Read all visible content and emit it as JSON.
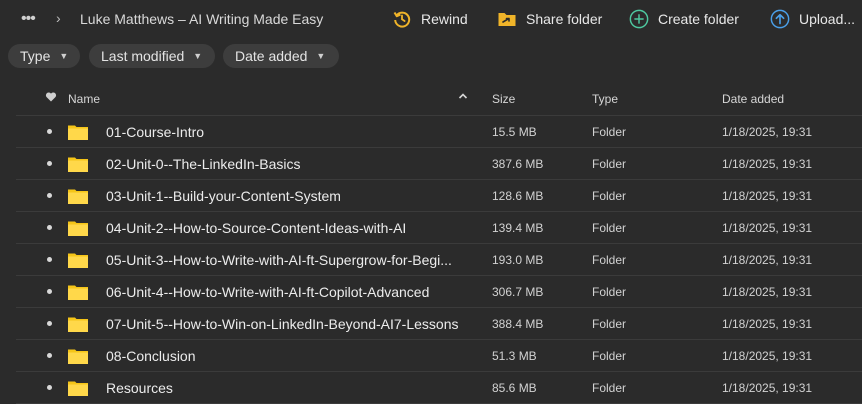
{
  "header": {
    "breadcrumb": "Luke Matthews – AI Writing Made Easy",
    "actions": [
      {
        "label": "Rewind",
        "icon": "rewind-icon",
        "color": "#f0b429"
      },
      {
        "label": "Share folder",
        "icon": "share-folder-icon",
        "color": "#f0b429"
      },
      {
        "label": "Create folder",
        "icon": "create-folder-icon",
        "color": "#4ec9a0"
      },
      {
        "label": "Upload...",
        "icon": "upload-icon",
        "color": "#4a9fe8"
      }
    ]
  },
  "filters": [
    {
      "label": "Type"
    },
    {
      "label": "Last modified"
    },
    {
      "label": "Date added"
    }
  ],
  "table": {
    "columns": {
      "name": "Name",
      "size": "Size",
      "type": "Type",
      "date": "Date added"
    },
    "rows": [
      {
        "name": "01-Course-Intro",
        "size": "15.5 MB",
        "type": "Folder",
        "date": "1/18/2025, 19:31"
      },
      {
        "name": "02-Unit-0--The-LinkedIn-Basics",
        "size": "387.6 MB",
        "type": "Folder",
        "date": "1/18/2025, 19:31"
      },
      {
        "name": "03-Unit-1--Build-your-Content-System",
        "size": "128.6 MB",
        "type": "Folder",
        "date": "1/18/2025, 19:31"
      },
      {
        "name": "04-Unit-2--How-to-Source-Content-Ideas-with-AI",
        "size": "139.4 MB",
        "type": "Folder",
        "date": "1/18/2025, 19:31"
      },
      {
        "name": "05-Unit-3--How-to-Write-with-AI-ft-Supergrow-for-Begi...",
        "size": "193.0 MB",
        "type": "Folder",
        "date": "1/18/2025, 19:31"
      },
      {
        "name": "06-Unit-4--How-to-Write-with-AI-ft-Copilot-Advanced",
        "size": "306.7 MB",
        "type": "Folder",
        "date": "1/18/2025, 19:31"
      },
      {
        "name": "07-Unit-5--How-to-Win-on-LinkedIn-Beyond-AI7-Lessons",
        "size": "388.4 MB",
        "type": "Folder",
        "date": "1/18/2025, 19:31"
      },
      {
        "name": "08-Conclusion",
        "size": "51.3 MB",
        "type": "Folder",
        "date": "1/18/2025, 19:31"
      },
      {
        "name": "Resources",
        "size": "85.6 MB",
        "type": "Folder",
        "date": "1/18/2025, 19:31"
      }
    ]
  },
  "colors": {
    "folder": "#f5c518",
    "background": "#2b2b2b",
    "chip": "#3d3d3d"
  }
}
